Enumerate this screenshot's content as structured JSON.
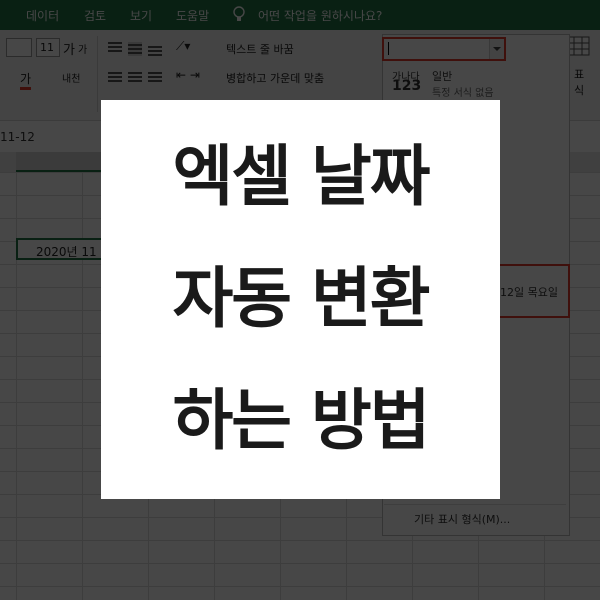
{
  "menu": {
    "items": [
      "데이터",
      "검토",
      "보기",
      "도움말"
    ],
    "tell_me": "어떤 작업을 원하시나요?"
  },
  "ribbon": {
    "font_size": "11",
    "grow_font": "가",
    "shrink_font": "가",
    "font_color": "가",
    "phonetic": "내천",
    "wrap_text": "텍스트 줄 바꿈",
    "merge_center": "병합하고 가운데 맞춤",
    "number_group_label": "표",
    "cell_style_label": "식"
  },
  "number_format": {
    "input_value": "",
    "general_sample_top": "가나다",
    "general_sample_num": "123",
    "general_name": "일반",
    "general_desc": "특정 서식 없음",
    "long_date_tail": "12일 목요일",
    "more_formats": "기타 표시 형식(M)..."
  },
  "sheet": {
    "formula_text": "11-12",
    "active_cell_value": "2020년 11"
  },
  "card": {
    "line1": "엑셀 날짜",
    "line2": "자동 변환",
    "line3": "하는 방법"
  },
  "colors": {
    "excel_green": "#217346",
    "highlight_red": "#e0392b"
  }
}
